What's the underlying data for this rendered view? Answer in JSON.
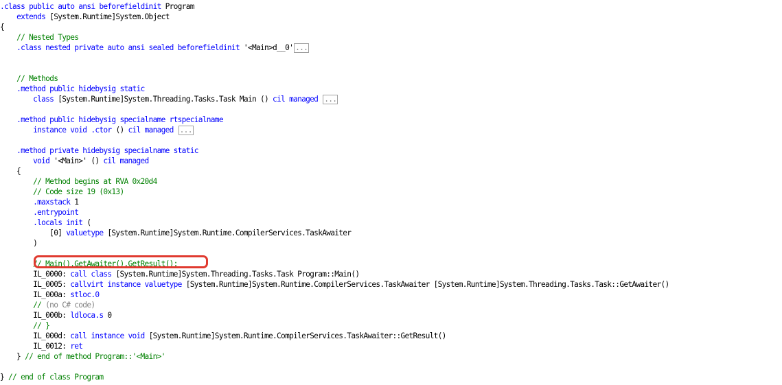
{
  "colors": {
    "keyword": "#0000ff",
    "comment": "#008000",
    "gray": "#808080",
    "plain": "#000000",
    "highlight_ring": "#e03a2f"
  },
  "code": {
    "lines": [
      [
        [
          "k",
          ".class public auto ansi beforefieldinit "
        ],
        [
          "p",
          "Program"
        ]
      ],
      [
        [
          "p",
          "    "
        ],
        [
          "k",
          "extends "
        ],
        [
          "p",
          "[System.Runtime]System.Object"
        ]
      ],
      [
        [
          "p",
          "{"
        ]
      ],
      [
        [
          "p",
          "    "
        ],
        [
          "c",
          "// Nested Types"
        ]
      ],
      [
        [
          "p",
          "    "
        ],
        [
          "k",
          ".class nested private auto ansi sealed beforefieldinit "
        ],
        [
          "p",
          "'<Main>d__0'"
        ],
        [
          "f",
          "..."
        ]
      ],
      [],
      [],
      [
        [
          "p",
          "    "
        ],
        [
          "c",
          "// Methods"
        ]
      ],
      [
        [
          "p",
          "    "
        ],
        [
          "k",
          ".method public hidebysig static"
        ]
      ],
      [
        [
          "p",
          "        "
        ],
        [
          "k",
          "class "
        ],
        [
          "p",
          "[System.Runtime]System.Threading.Tasks.Task Main () "
        ],
        [
          "k",
          "cil managed "
        ],
        [
          "f",
          "..."
        ]
      ],
      [],
      [
        [
          "p",
          "    "
        ],
        [
          "k",
          ".method public hidebysig specialname rtspecialname"
        ]
      ],
      [
        [
          "p",
          "        "
        ],
        [
          "k",
          "instance void .ctor "
        ],
        [
          "p",
          "() "
        ],
        [
          "k",
          "cil managed "
        ],
        [
          "f",
          "..."
        ]
      ],
      [],
      [
        [
          "p",
          "    "
        ],
        [
          "k",
          ".method private hidebysig specialname static"
        ]
      ],
      [
        [
          "p",
          "        "
        ],
        [
          "k",
          "void "
        ],
        [
          "p",
          "'<Main>' () "
        ],
        [
          "k",
          "cil managed"
        ]
      ],
      [
        [
          "p",
          "    {"
        ]
      ],
      [
        [
          "p",
          "        "
        ],
        [
          "c",
          "// Method begins at RVA 0x20d4"
        ]
      ],
      [
        [
          "p",
          "        "
        ],
        [
          "c",
          "// Code size 19 (0x13)"
        ]
      ],
      [
        [
          "p",
          "        "
        ],
        [
          "k",
          ".maxstack "
        ],
        [
          "p",
          "1"
        ]
      ],
      [
        [
          "p",
          "        "
        ],
        [
          "k",
          ".entrypoint"
        ]
      ],
      [
        [
          "p",
          "        "
        ],
        [
          "k",
          ".locals init "
        ],
        [
          "p",
          "("
        ]
      ],
      [
        [
          "p",
          "            [0] "
        ],
        [
          "k",
          "valuetype "
        ],
        [
          "p",
          "[System.Runtime]System.Runtime.CompilerServices.TaskAwaiter"
        ]
      ],
      [
        [
          "p",
          "        )"
        ]
      ],
      [],
      [
        [
          "p",
          "        "
        ],
        [
          "c",
          "// Main().GetAwaiter().GetResult();"
        ]
      ],
      [
        [
          "p",
          "        IL_0000: "
        ],
        [
          "k",
          "call class "
        ],
        [
          "p",
          "[System.Runtime]System.Threading.Tasks.Task Program::Main()"
        ]
      ],
      [
        [
          "p",
          "        IL_0005: "
        ],
        [
          "k",
          "callvirt instance valuetype "
        ],
        [
          "p",
          "[System.Runtime]System.Runtime.CompilerServices.TaskAwaiter [System.Runtime]System.Threading.Tasks.Task::GetAwaiter()"
        ]
      ],
      [
        [
          "p",
          "        IL_000a: "
        ],
        [
          "k",
          "stloc.0"
        ]
      ],
      [
        [
          "p",
          "        "
        ],
        [
          "c",
          "// "
        ],
        [
          "g",
          "(no C# code)"
        ]
      ],
      [
        [
          "p",
          "        IL_000b: "
        ],
        [
          "k",
          "ldloca.s "
        ],
        [
          "p",
          "0"
        ]
      ],
      [
        [
          "p",
          "        "
        ],
        [
          "c",
          "// }"
        ]
      ],
      [
        [
          "p",
          "        IL_000d: "
        ],
        [
          "k",
          "call instance void "
        ],
        [
          "p",
          "[System.Runtime]System.Runtime.CompilerServices.TaskAwaiter::GetResult()"
        ]
      ],
      [
        [
          "p",
          "        IL_0012: "
        ],
        [
          "k",
          "ret"
        ]
      ],
      [
        [
          "p",
          "    } "
        ],
        [
          "c",
          "// end of method Program::'<Main>'"
        ]
      ],
      [],
      [
        [
          "p",
          "} "
        ],
        [
          "c",
          "// end of class Program"
        ]
      ]
    ]
  }
}
